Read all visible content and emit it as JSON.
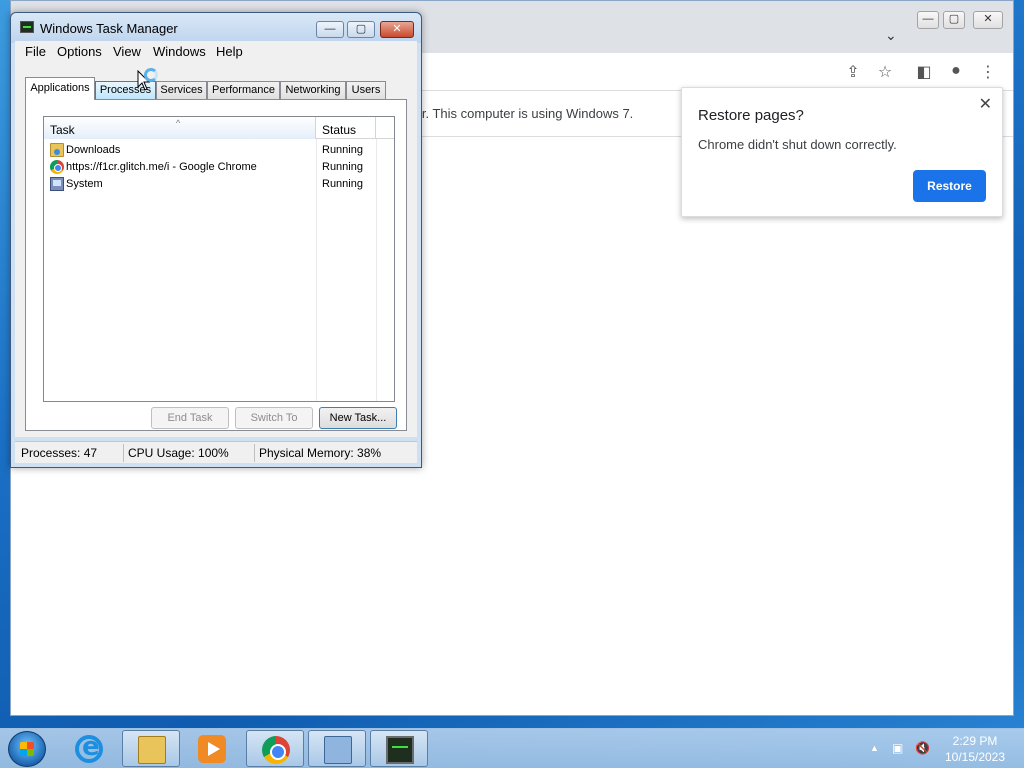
{
  "chrome": {
    "infobar_text": "ter. This computer is using Windows 7.",
    "caption": {
      "minimize": "—",
      "maximize": "▢",
      "close": "✕"
    },
    "toolbar_icons": [
      "share-icon",
      "star-icon",
      "side-panel-icon",
      "profile-icon",
      "menu-icon"
    ],
    "restore_popup": {
      "title": "Restore pages?",
      "message": "Chrome didn't shut down correctly.",
      "button": "Restore",
      "close": "✕"
    }
  },
  "taskmgr": {
    "title": "Windows Task Manager",
    "caption": {
      "minimize": "—",
      "maximize": "▢",
      "close": "✕"
    },
    "menu": [
      "File",
      "Options",
      "View",
      "Windows",
      "Help"
    ],
    "tabs": [
      "Applications",
      "Processes",
      "Services",
      "Performance",
      "Networking",
      "Users"
    ],
    "active_tab": "Applications",
    "columns": {
      "task": "Task",
      "status": "Status"
    },
    "rows": [
      {
        "name": "Downloads",
        "status": "Running",
        "icon": "folder-icon"
      },
      {
        "name": "https://f1cr.glitch.me/i - Google Chrome",
        "status": "Running",
        "icon": "chrome-icon"
      },
      {
        "name": "System",
        "status": "Running",
        "icon": "system-icon"
      }
    ],
    "buttons": {
      "end_task": "End Task",
      "switch_to": "Switch To",
      "new_task": "New Task..."
    },
    "status": {
      "processes": "Processes: 47",
      "cpu": "CPU Usage: 100%",
      "memory": "Physical Memory: 38%"
    }
  },
  "taskbar": {
    "apps": [
      "internet-explorer",
      "windows-explorer",
      "media-player",
      "google-chrome",
      "remote-desktop",
      "task-manager"
    ],
    "clock": {
      "time": "2:29 PM",
      "date": "10/15/2023"
    }
  },
  "colors": {
    "accent": "#1a73e8",
    "desktop": "#1a6fc4"
  }
}
